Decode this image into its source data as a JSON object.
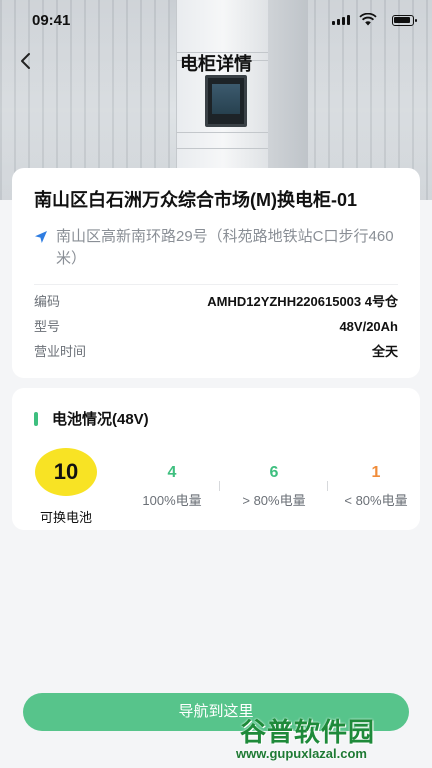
{
  "status_bar": {
    "time": "09:41"
  },
  "header": {
    "title": "电柜详情"
  },
  "station": {
    "name": "南山区白石洲万众综合市场(M)换电柜-01",
    "address": "南山区高新南环路29号（科苑路地铁站C口步行460米）",
    "details": [
      {
        "label": "编码",
        "value": "AMHD12YZHH220615003 4号仓"
      },
      {
        "label": "型号",
        "value": "48V/20Ah"
      },
      {
        "label": "营业时间",
        "value": "全天"
      }
    ]
  },
  "battery": {
    "title": "电池情况(48V)",
    "swappable": {
      "count": "10",
      "label": "可换电池"
    },
    "stats": [
      {
        "value": "4",
        "label": "100%电量",
        "color": "#3ebf7f"
      },
      {
        "value": "6",
        "label": "> 80%电量",
        "color": "#3ebf7f"
      },
      {
        "value": "1",
        "label": "< 80%电量",
        "color": "#f08c3a"
      }
    ]
  },
  "actions": {
    "navigate_label": "导航到这里"
  },
  "watermark": {
    "title": "谷普软件园",
    "url": "www.gupuxlazal.com"
  }
}
